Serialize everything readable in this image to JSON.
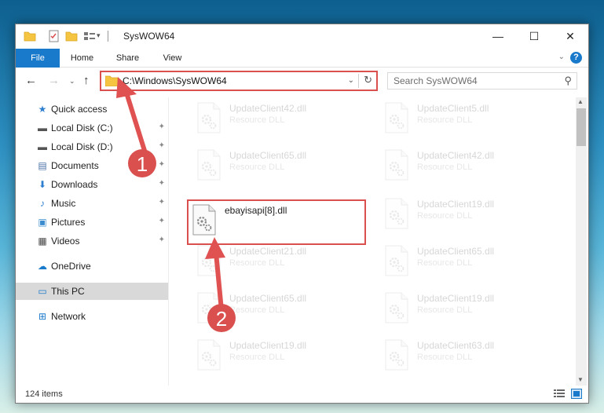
{
  "window": {
    "title": "SysWOW64",
    "minimize_glyph": "—",
    "maximize_glyph": "☐",
    "close_glyph": "✕"
  },
  "ribbon": {
    "tabs": [
      "File",
      "Home",
      "Share",
      "View"
    ],
    "expand_glyph": "⌄",
    "help_glyph": "?"
  },
  "nav": {
    "back_glyph": "←",
    "forward_glyph": "→",
    "recent_glyph": "⌄",
    "up_glyph": "↑"
  },
  "address": {
    "path": "C:\\Windows\\SysWOW64",
    "dropdown_glyph": "⌄",
    "refresh_glyph": "↻"
  },
  "search": {
    "placeholder": "Search SysWOW64",
    "icon_glyph": "⚲"
  },
  "sidebar": {
    "items": [
      {
        "label": "Quick access",
        "icon": "star-icon",
        "glyph": "★",
        "color": "#2f7fd0",
        "pinned": false
      },
      {
        "label": "Local Disk (C:)",
        "icon": "drive-icon",
        "glyph": "▬",
        "color": "#555555",
        "pinned": true
      },
      {
        "label": "Local Disk (D:)",
        "icon": "drive-icon",
        "glyph": "▬",
        "color": "#555555",
        "pinned": true
      },
      {
        "label": "Documents",
        "icon": "document-icon",
        "glyph": "▤",
        "color": "#4a6fa5",
        "pinned": true
      },
      {
        "label": "Downloads",
        "icon": "download-icon",
        "glyph": "⬇",
        "color": "#2f7fd0",
        "pinned": true
      },
      {
        "label": "Music",
        "icon": "music-icon",
        "glyph": "♪",
        "color": "#2f7fd0",
        "pinned": true
      },
      {
        "label": "Pictures",
        "icon": "pictures-icon",
        "glyph": "▣",
        "color": "#3a8ccf",
        "pinned": true
      },
      {
        "label": "Videos",
        "icon": "video-icon",
        "glyph": "▦",
        "color": "#444444",
        "pinned": true
      },
      {
        "label": "OneDrive",
        "icon": "cloud-icon",
        "glyph": "☁",
        "color": "#1979ca",
        "pinned": false
      },
      {
        "label": "This PC",
        "icon": "computer-icon",
        "glyph": "▭",
        "color": "#1979ca",
        "pinned": false
      },
      {
        "label": "Network",
        "icon": "network-icon",
        "glyph": "⊞",
        "color": "#1979ca",
        "pinned": false
      }
    ],
    "pin_glyph": "✦"
  },
  "files": [
    {
      "name": "UpdateClient42.dll",
      "type": "Resource DLL"
    },
    {
      "name": "UpdateClient5.dll",
      "type": "Resource DLL"
    },
    {
      "name": "UpdateClient65.dll",
      "type": "Resource DLL"
    },
    {
      "name": "UpdateClient42.dll",
      "type": "Resource DLL"
    },
    {
      "name": "ebayisapi[8].dll",
      "type": ""
    },
    {
      "name": "UpdateClient19.dll",
      "type": "Resource DLL"
    },
    {
      "name": "UpdateClient21.dll",
      "type": "Resource DLL"
    },
    {
      "name": "UpdateClient65.dll",
      "type": "Resource DLL"
    },
    {
      "name": "UpdateClient65.dll",
      "type": "Resource DLL"
    },
    {
      "name": "UpdateClient19.dll",
      "type": "Resource DLL"
    },
    {
      "name": "UpdateClient19.dll",
      "type": "Resource DLL"
    },
    {
      "name": "UpdateClient63.dll",
      "type": "Resource DLL"
    }
  ],
  "status": {
    "item_count": "124 items"
  },
  "annotations": {
    "step1": "1",
    "step2": "2",
    "color": "#d9504f"
  },
  "scroll": {
    "up_glyph": "▲",
    "down_glyph": "▼"
  }
}
